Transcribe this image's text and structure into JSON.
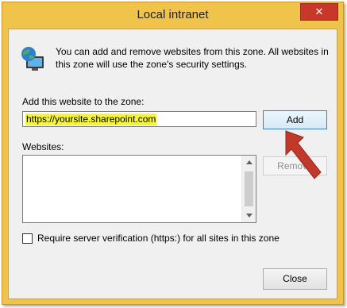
{
  "dialog": {
    "title": "Local intranet",
    "close_glyph": "✕",
    "intro_text": "You can add and remove websites from this zone. All websites in this zone will use the zone's security settings.",
    "add_label": "Add this website to the zone:",
    "website_input_value": "https://yoursite.sharepoint.com",
    "add_button": "Add",
    "websites_label": "Websites:",
    "remove_button": "Remove",
    "checkbox_label": "Require server verification (https:) for all sites in this zone",
    "checkbox_checked": false,
    "close_button": "Close"
  },
  "icons": {
    "globe": "globe-computer-icon",
    "close": "close-icon",
    "arrow": "annotation-arrow"
  },
  "colors": {
    "title_bar": "#f0c34a",
    "close_button": "#c7372a",
    "input_highlight": "#f5f53a",
    "arrow": "#c0392b"
  }
}
